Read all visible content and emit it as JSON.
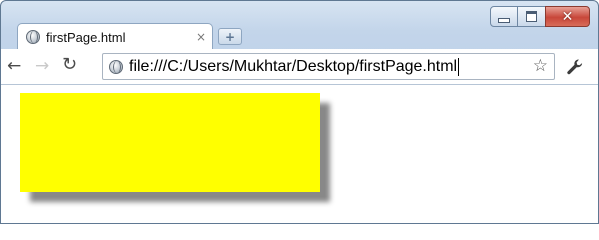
{
  "tab": {
    "title": "firstPage.html",
    "close_glyph": "×"
  },
  "newtab": {
    "glyph": "+"
  },
  "window_controls": {
    "close_glyph": "✕"
  },
  "nav": {
    "back_glyph": "←",
    "forward_glyph": "→",
    "reload_glyph": "↻"
  },
  "omnibox": {
    "url": "file:///C:/Users/Mukhtar/Desktop/firstPage.html",
    "star_glyph": "☆"
  },
  "page": {
    "box_color": "#ffff00"
  },
  "icons": [
    "globe-icon",
    "minimize-icon",
    "maximize-icon",
    "close-icon",
    "new-tab-icon",
    "back-arrow-icon",
    "forward-arrow-icon",
    "reload-icon",
    "page-icon",
    "star-icon",
    "wrench-icon"
  ]
}
